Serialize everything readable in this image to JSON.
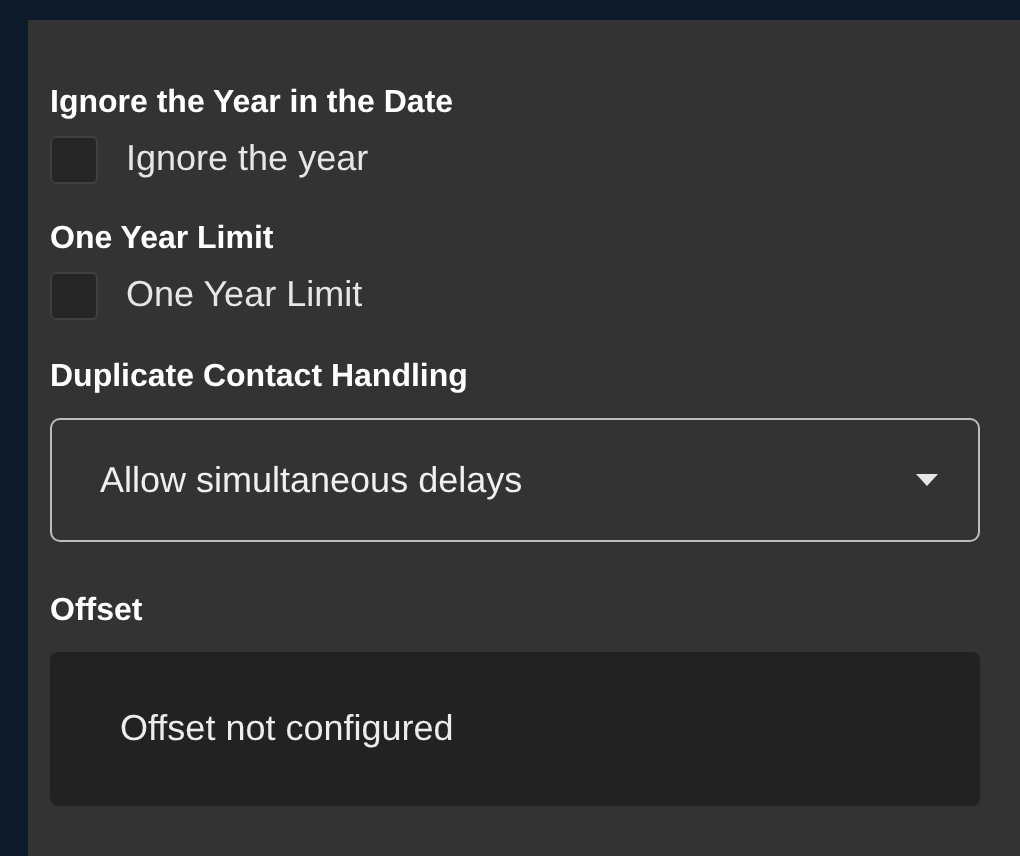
{
  "sections": [
    {
      "kind": "checkbox",
      "heading": "Ignore the Year in the Date",
      "label": "Ignore the year",
      "checked": false
    },
    {
      "kind": "checkbox",
      "heading": "One Year Limit",
      "label": "One Year Limit",
      "checked": false
    },
    {
      "kind": "select",
      "heading": "Duplicate Contact Handling",
      "value": "Allow simultaneous delays"
    },
    {
      "kind": "note",
      "heading": "Offset",
      "text": "Offset not configured"
    }
  ]
}
